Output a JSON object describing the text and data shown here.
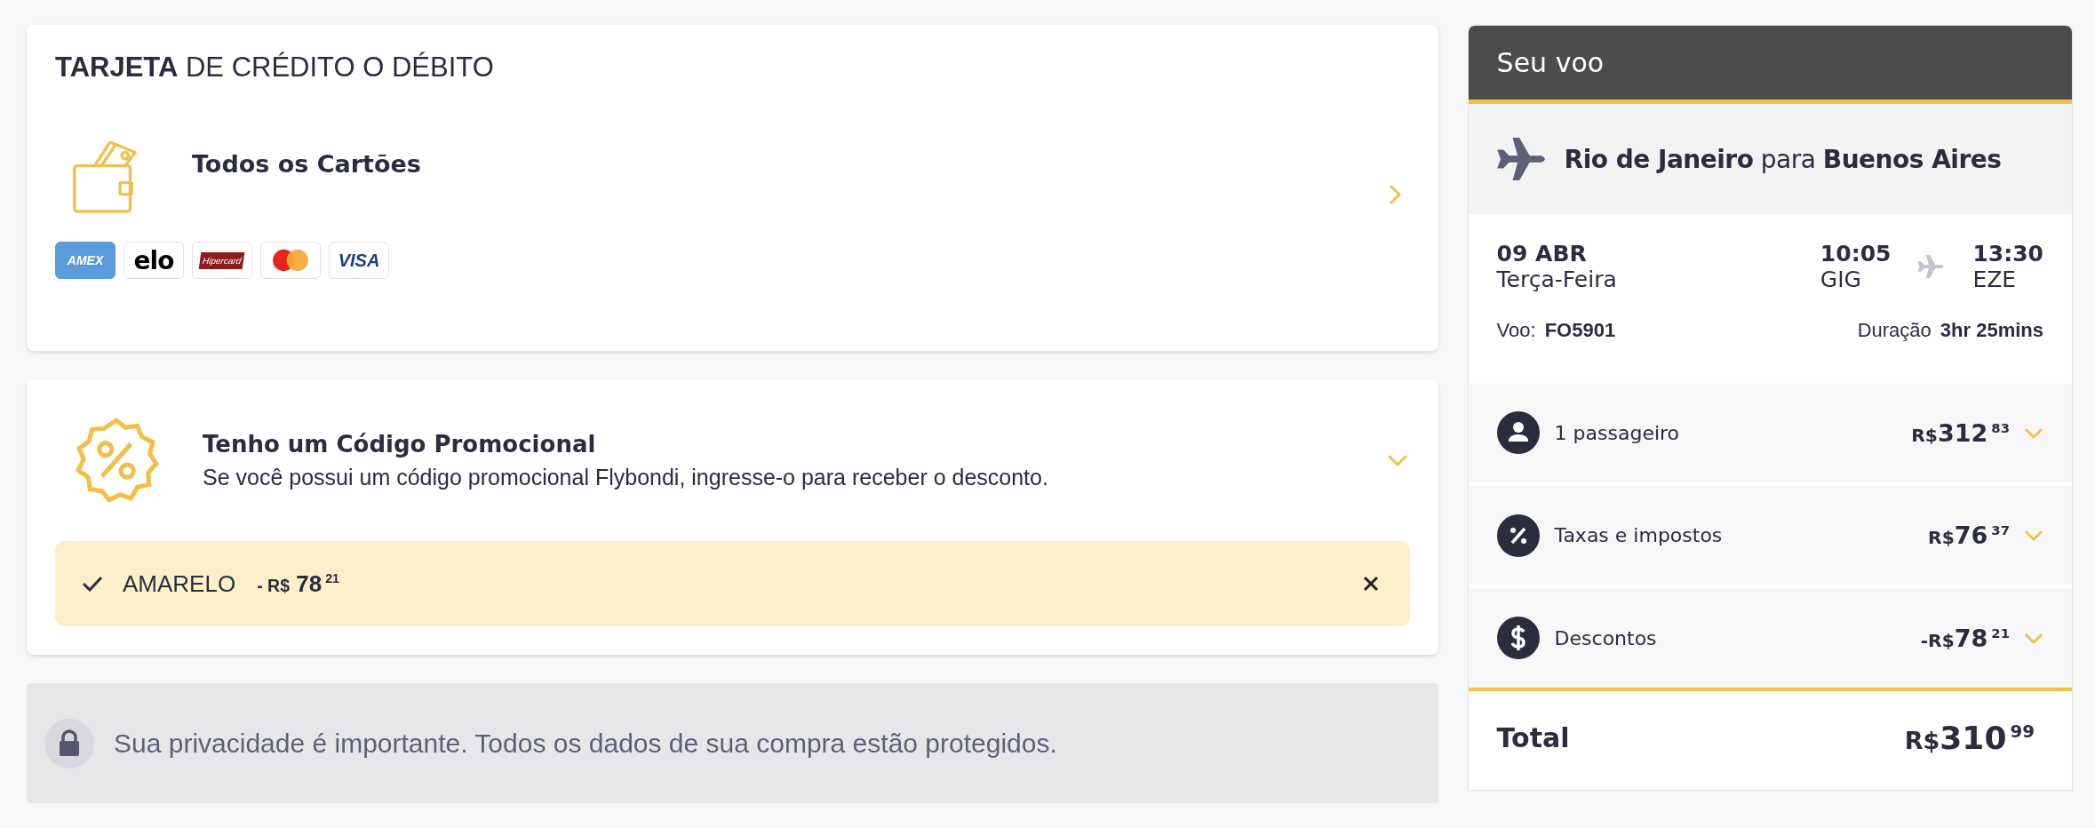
{
  "payment": {
    "title": "**TARJETA** DE CRÉDITO O DÉBITO",
    "option": {
      "label": "Todos os Cartões"
    },
    "brands": [
      {
        "kind": "amex",
        "label": "AMEX"
      },
      {
        "kind": "elo",
        "label": "elo"
      },
      {
        "kind": "hipercard",
        "label": "Hipercard"
      },
      {
        "kind": "mastercard"
      },
      {
        "kind": "visa",
        "label": "VISA"
      }
    ]
  },
  "promo": {
    "title": "Tenho um Código Promocional",
    "description": "Se você possui um código promocional Flybondi, ingresse-o para receber o desconto.",
    "applied": {
      "code": "AMARELO",
      "discount": {
        "prefix": "- R$",
        "amount": "78",
        "cents": "21"
      }
    }
  },
  "privacy": {
    "text": "Sua privacidade é importante. Todos os dados de sua compra estão protegidos."
  },
  "flight": {
    "header": "Seu voo",
    "route": "**Rio de Janeiro** para **Buenos Aires**",
    "date": "09 ABR",
    "weekday": "Terça-Feira",
    "departure": {
      "time": "10:05",
      "airport": "GIG"
    },
    "arrival": {
      "time": "13:30",
      "airport": "EZE"
    },
    "flight_label": "Voo:",
    "flight_number": "FO5901",
    "duration_label": "Duração",
    "duration": "3hr 25mins",
    "breakdown": [
      {
        "kind": "person",
        "label": "1 passageiro",
        "price": {
          "prefix": "R$",
          "amount": "312",
          "cents": "83"
        }
      },
      {
        "kind": "percent",
        "label": "Taxas e impostos",
        "price": {
          "prefix": "R$",
          "amount": "76",
          "cents": "37"
        }
      },
      {
        "kind": "dollar",
        "label": "Descontos",
        "price": {
          "prefix": "-R$",
          "amount": "78",
          "cents": "21"
        }
      }
    ],
    "total": {
      "label": "Total",
      "price": {
        "prefix": "R$",
        "amount": "310",
        "cents": "99"
      }
    }
  }
}
